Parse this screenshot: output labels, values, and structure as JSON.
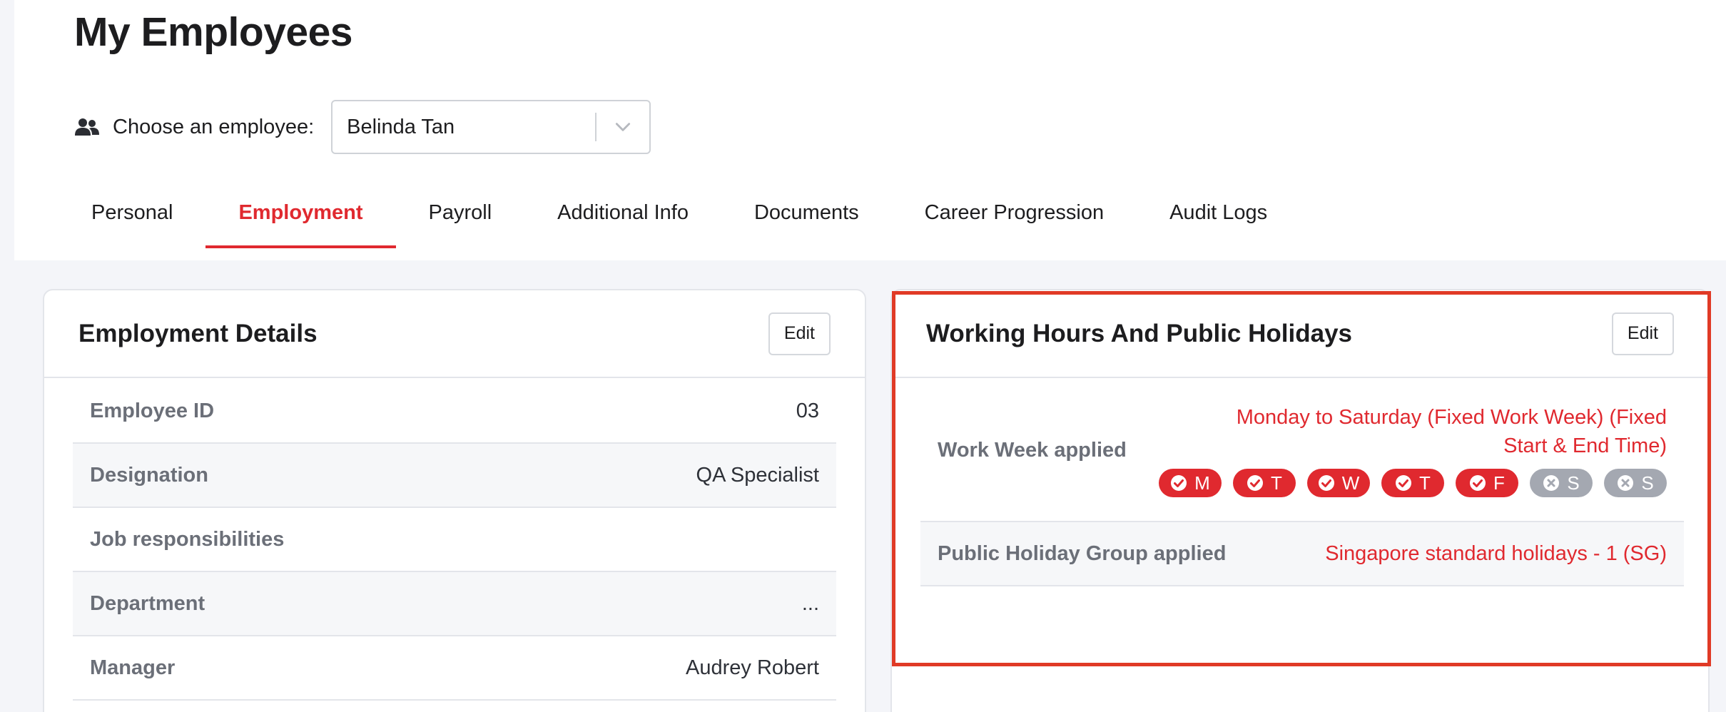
{
  "page": {
    "title": "My Employees"
  },
  "chooser": {
    "label": "Choose an employee:",
    "selected": "Belinda Tan",
    "icon": "people-icon"
  },
  "tabs": [
    {
      "label": "Personal",
      "active": false
    },
    {
      "label": "Employment",
      "active": true
    },
    {
      "label": "Payroll",
      "active": false
    },
    {
      "label": "Additional Info",
      "active": false
    },
    {
      "label": "Documents",
      "active": false
    },
    {
      "label": "Career Progression",
      "active": false
    },
    {
      "label": "Audit Logs",
      "active": false
    }
  ],
  "employment_details": {
    "title": "Employment Details",
    "edit_label": "Edit",
    "rows": [
      {
        "label": "Employee ID",
        "value": "03"
      },
      {
        "label": "Designation",
        "value": "QA Specialist"
      },
      {
        "label": "Job responsibilities",
        "value": ""
      },
      {
        "label": "Department",
        "value": "..."
      },
      {
        "label": "Manager",
        "value": "Audrey Robert"
      }
    ]
  },
  "working_hours": {
    "title": "Working Hours And Public Holidays",
    "edit_label": "Edit",
    "work_week": {
      "label": "Work Week applied",
      "value": "Monday to Saturday (Fixed Work Week) (Fixed Start & End Time)",
      "days": [
        {
          "letter": "M",
          "enabled": true
        },
        {
          "letter": "T",
          "enabled": true
        },
        {
          "letter": "W",
          "enabled": true
        },
        {
          "letter": "T",
          "enabled": true
        },
        {
          "letter": "F",
          "enabled": true
        },
        {
          "letter": "S",
          "enabled": false
        },
        {
          "letter": "S",
          "enabled": false
        }
      ]
    },
    "public_holiday": {
      "label": "Public Holiday Group applied",
      "value": "Singapore standard holidays - 1 (SG)"
    }
  },
  "colors": {
    "accent": "#e0292f",
    "highlight": "#e03a26",
    "muted_label": "#6b6f78",
    "pill_off": "#a4a8b1"
  }
}
